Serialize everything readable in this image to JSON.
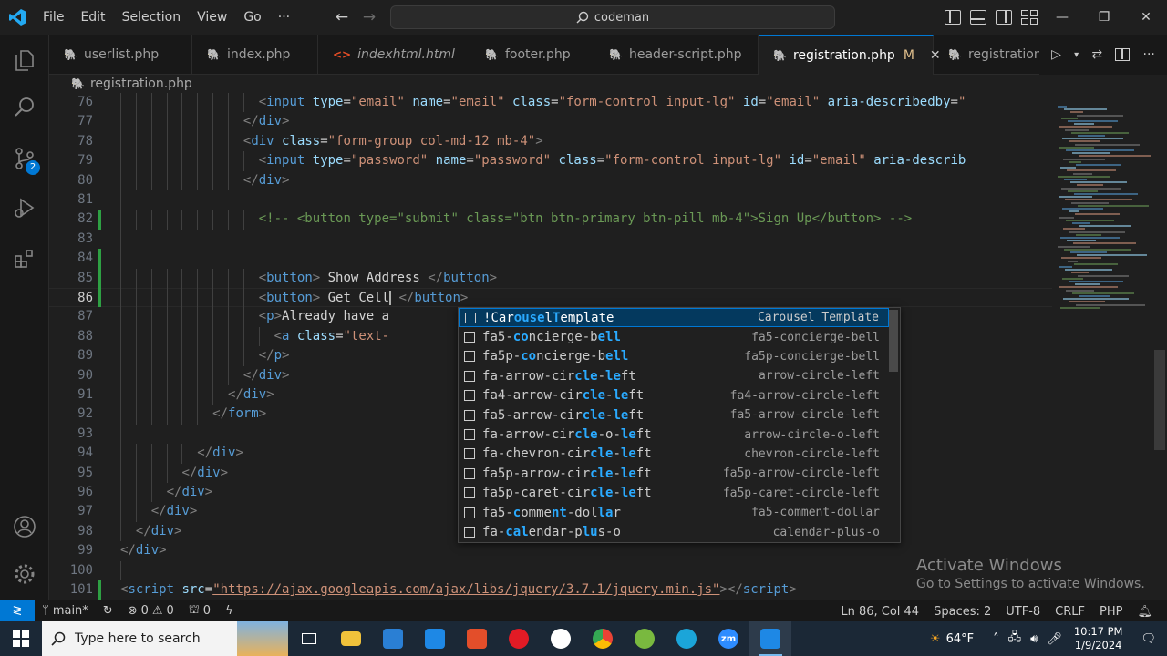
{
  "titlebar": {
    "menu": [
      "File",
      "Edit",
      "Selection",
      "View",
      "Go",
      "···"
    ],
    "search_text": "codeman"
  },
  "activity": {
    "source_control_badge": "2"
  },
  "tabs": [
    {
      "label": "userlist.php",
      "kind": "php",
      "italic": false,
      "active": false
    },
    {
      "label": "index.php",
      "kind": "php",
      "italic": false,
      "active": false
    },
    {
      "label": "indexhtml.html",
      "kind": "html",
      "italic": true,
      "active": false
    },
    {
      "label": "footer.php",
      "kind": "php",
      "italic": false,
      "active": false
    },
    {
      "label": "header-script.php",
      "kind": "php",
      "italic": false,
      "active": false
    },
    {
      "label": "registration.php",
      "kind": "php",
      "italic": false,
      "active": true,
      "modified": "M"
    },
    {
      "label": "registration-",
      "kind": "php",
      "italic": false,
      "active": false
    }
  ],
  "breadcrumb": "registration.php",
  "editor": {
    "current_line": 86,
    "lines": [
      {
        "n": "76",
        "indent": 16,
        "html": "<span class='t-tag'>&lt;</span><span class='t-name'>input</span> <span class='t-attr'>type</span>=<span class='t-str'>\"email\"</span> <span class='t-attr'>name</span>=<span class='t-str'>\"email\"</span> <span class='t-attr'>class</span>=<span class='t-str'>\"form-control input-lg\"</span> <span class='t-attr'>id</span>=<span class='t-str'>\"email\"</span> <span class='t-attr'>aria-describedby</span>=<span class='t-str'>\"</span>"
      },
      {
        "n": "77",
        "indent": 14,
        "html": "<span class='t-tag'>&lt;/</span><span class='t-name'>div</span><span class='t-tag'>&gt;</span>"
      },
      {
        "n": "78",
        "indent": 14,
        "html": "<span class='t-tag'>&lt;</span><span class='t-name'>div</span> <span class='t-attr'>class</span>=<span class='t-str'>\"form-group col-md-12 mb-4\"</span><span class='t-tag'>&gt;</span>"
      },
      {
        "n": "79",
        "indent": 16,
        "html": "<span class='t-tag'>&lt;</span><span class='t-name'>input</span> <span class='t-attr'>type</span>=<span class='t-str'>\"password\"</span> <span class='t-attr'>name</span>=<span class='t-str'>\"password\"</span> <span class='t-attr'>class</span>=<span class='t-str'>\"form-control input-lg\"</span> <span class='t-attr'>id</span>=<span class='t-str'>\"email\"</span> <span class='t-attr'>aria-describ</span>"
      },
      {
        "n": "80",
        "indent": 14,
        "html": "<span class='t-tag'>&lt;/</span><span class='t-name'>div</span><span class='t-tag'>&gt;</span>"
      },
      {
        "n": "81",
        "indent": 0,
        "html": ""
      },
      {
        "n": "82",
        "indent": 16,
        "html": "<span class='t-cmt'>&lt;!-- &lt;button type=\"submit\" class=\"btn btn-primary btn-pill mb-4\"&gt;Sign Up&lt;/button&gt; --&gt;</span>"
      },
      {
        "n": "83",
        "indent": 0,
        "html": ""
      },
      {
        "n": "84",
        "indent": 0,
        "html": ""
      },
      {
        "n": "85",
        "indent": 16,
        "html": "<span class='t-tag'>&lt;</span><span class='t-name'>button</span><span class='t-tag'>&gt;</span><span class='t-text'> Show Address </span><span class='t-tag'>&lt;/</span><span class='t-name'>button</span><span class='t-tag'>&gt;</span>"
      },
      {
        "n": "86",
        "indent": 16,
        "html": "<span class='t-tag'>&lt;</span><span class='t-name'>button</span><span class='t-tag'>&gt;</span><span class='t-text'> Get Cell</span><span style='border-left:2px solid #aeafad'></span> <span class='t-tag'>&lt;/</span><span class='t-name'>button</span><span class='t-tag'>&gt;</span>"
      },
      {
        "n": "87",
        "indent": 16,
        "html": "<span class='t-tag'>&lt;</span><span class='t-name'>p</span><span class='t-tag'>&gt;</span><span class='t-text'>Already have a</span>"
      },
      {
        "n": "88",
        "indent": 18,
        "html": "<span class='t-tag'>&lt;</span><span class='t-name'>a</span> <span class='t-attr'>class</span>=<span class='t-str'>\"text-</span>"
      },
      {
        "n": "89",
        "indent": 16,
        "html": "<span class='t-tag'>&lt;/</span><span class='t-name'>p</span><span class='t-tag'>&gt;</span>"
      },
      {
        "n": "90",
        "indent": 14,
        "html": "<span class='t-tag'>&lt;/</span><span class='t-name'>div</span><span class='t-tag'>&gt;</span>"
      },
      {
        "n": "91",
        "indent": 12,
        "html": "<span class='t-tag'>&lt;/</span><span class='t-name'>div</span><span class='t-tag'>&gt;</span>"
      },
      {
        "n": "92",
        "indent": 10,
        "html": "<span class='t-tag'>&lt;/</span><span class='t-name'>form</span><span class='t-tag'>&gt;</span>"
      },
      {
        "n": "93",
        "indent": 0,
        "html": ""
      },
      {
        "n": "94",
        "indent": 8,
        "html": "<span class='t-tag'>&lt;/</span><span class='t-name'>div</span><span class='t-tag'>&gt;</span>"
      },
      {
        "n": "95",
        "indent": 6,
        "html": "<span class='t-tag'>&lt;/</span><span class='t-name'>div</span><span class='t-tag'>&gt;</span>"
      },
      {
        "n": "96",
        "indent": 4,
        "html": "<span class='t-tag'>&lt;/</span><span class='t-name'>div</span><span class='t-tag'>&gt;</span>"
      },
      {
        "n": "97",
        "indent": 2,
        "html": "<span class='t-tag'>&lt;/</span><span class='t-name'>div</span><span class='t-tag'>&gt;</span>"
      },
      {
        "n": "98",
        "indent": 0,
        "html": "<span class='t-tag'>&lt;/</span><span class='t-name'>div</span><span class='t-tag'>&gt;</span>"
      },
      {
        "n": "99",
        "indent": -2,
        "html": "<span class='t-tag'>&lt;/</span><span class='t-name'>div</span><span class='t-tag'>&gt;</span>"
      },
      {
        "n": "100",
        "indent": 0,
        "html": ""
      },
      {
        "n": "101",
        "indent": -2,
        "html": "<span class='t-tag'>&lt;</span><span class='t-name'>script</span> <span class='t-attr'>src</span>=<span class='t-str' style='text-decoration:underline'>\"https://ajax.googleapis.com/ajax/libs/jquery/3.7.1/jquery.min.js\"</span><span class='t-tag'>&gt;&lt;/</span><span class='t-name'>script</span><span class='t-tag'>&gt;</span>"
      }
    ]
  },
  "suggestions": [
    {
      "label": "!CarouselTemplate",
      "hl": [
        4,
        5,
        6,
        7,
        9
      ],
      "detail": "Carousel Template",
      "selected": true
    },
    {
      "label": "fa5-concierge-bell",
      "hl": [
        4,
        5,
        15,
        16,
        17
      ],
      "detail": "fa5-concierge-bell",
      "selected": false
    },
    {
      "label": "fa5p-concierge-bell",
      "hl": [
        5,
        6,
        16,
        17,
        18
      ],
      "detail": "fa5p-concierge-bell",
      "selected": false
    },
    {
      "label": "fa-arrow-circle-left",
      "hl": [
        12,
        13,
        14,
        16,
        17
      ],
      "detail": "arrow-circle-left",
      "selected": false
    },
    {
      "label": "fa4-arrow-circle-left",
      "hl": [
        13,
        14,
        15,
        17,
        18
      ],
      "detail": "fa4-arrow-circle-left",
      "selected": false
    },
    {
      "label": "fa5-arrow-circle-left",
      "hl": [
        13,
        14,
        15,
        17,
        18
      ],
      "detail": "fa5-arrow-circle-left",
      "selected": false
    },
    {
      "label": "fa-arrow-circle-o-left",
      "hl": [
        12,
        13,
        14,
        18,
        19
      ],
      "detail": "arrow-circle-o-left",
      "selected": false
    },
    {
      "label": "fa-chevron-circle-left",
      "hl": [
        14,
        15,
        16,
        18,
        19
      ],
      "detail": "chevron-circle-left",
      "selected": false
    },
    {
      "label": "fa5p-arrow-circle-left",
      "hl": [
        14,
        15,
        16,
        18,
        19
      ],
      "detail": "fa5p-arrow-circle-left",
      "selected": false
    },
    {
      "label": "fa5p-caret-circle-left",
      "hl": [
        14,
        15,
        16,
        18,
        19
      ],
      "detail": "fa5p-caret-circle-left",
      "selected": false
    },
    {
      "label": "fa5-comment-dollar",
      "hl": [
        4,
        9,
        10,
        15,
        16
      ],
      "detail": "fa5-comment-dollar",
      "selected": false
    },
    {
      "label": "fa-calendar-plus-o",
      "hl": [
        3,
        4,
        5,
        13,
        14
      ],
      "detail": "calendar-plus-o",
      "selected": false
    }
  ],
  "watermark": {
    "title": "Activate Windows",
    "subtitle": "Go to Settings to activate Windows."
  },
  "statusbar": {
    "branch": "main*",
    "errors": "0",
    "warnings": "0",
    "ports": "0",
    "position": "Ln 86, Col 44",
    "spaces": "Spaces: 2",
    "encoding": "UTF-8",
    "eol": "CRLF",
    "language": "PHP"
  },
  "taskbar": {
    "search_placeholder": "Type here to search",
    "weather": "64°F",
    "time": "10:17 PM",
    "date": "1/9/2024"
  }
}
